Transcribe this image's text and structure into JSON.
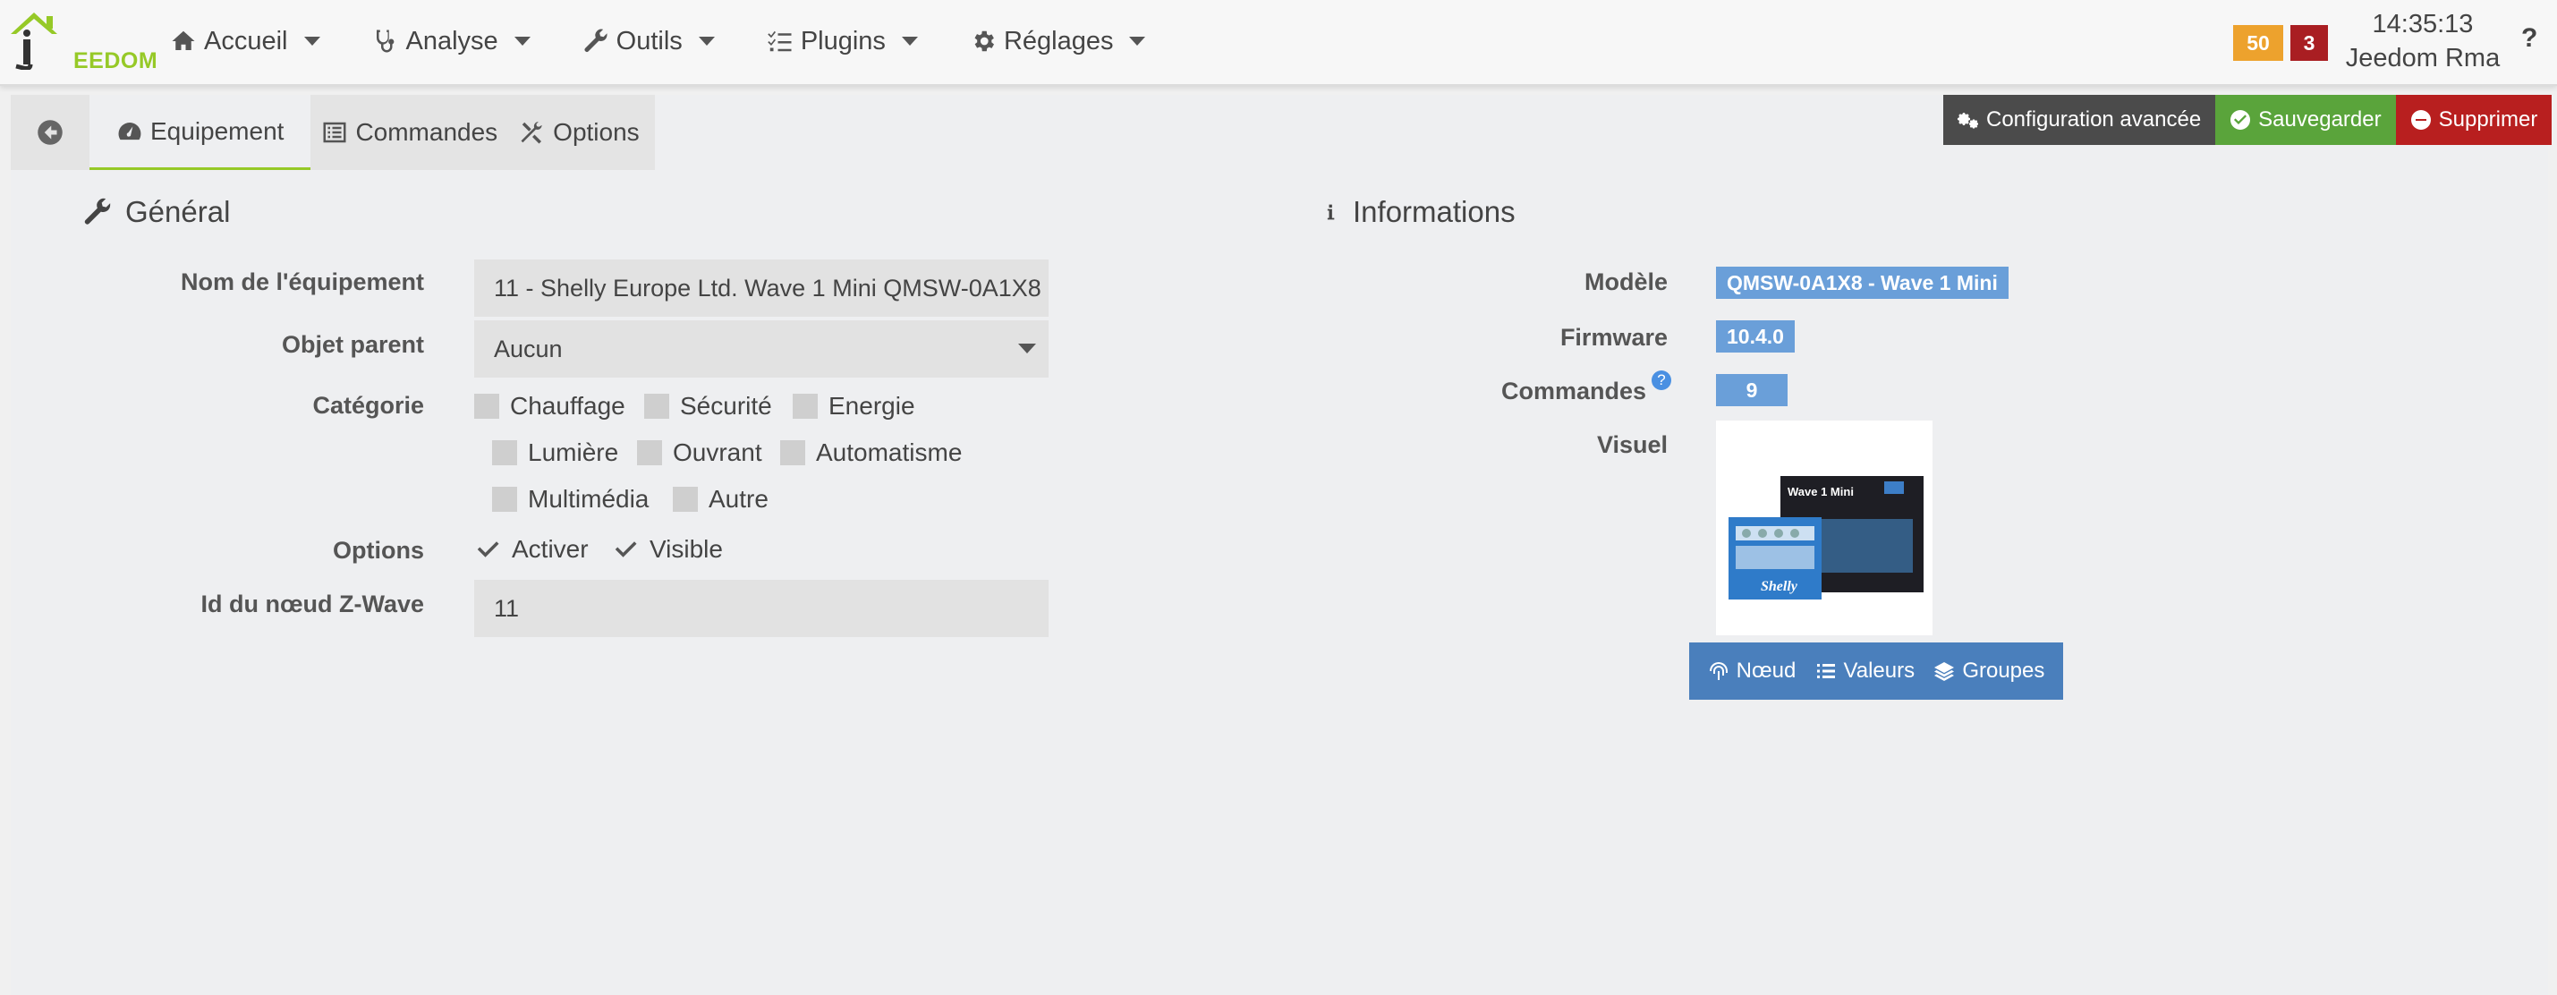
{
  "navbar": {
    "logo_text": "EEDOM",
    "menu": [
      {
        "label": "Accueil",
        "icon": "home-icon"
      },
      {
        "label": "Analyse",
        "icon": "stethoscope-icon"
      },
      {
        "label": "Outils",
        "icon": "wrench-icon"
      },
      {
        "label": "Plugins",
        "icon": "tasks-icon"
      },
      {
        "label": "Réglages",
        "icon": "cog-icon"
      }
    ],
    "badge_orange": "50",
    "badge_red": "3",
    "time": "14:35:13",
    "user": "Jeedom Rma",
    "help": "?"
  },
  "tabs": {
    "equipement": "Equipement",
    "commandes": "Commandes",
    "options": "Options"
  },
  "actions": {
    "config": "Configuration avancée",
    "save": "Sauvegarder",
    "delete": "Supprimer"
  },
  "general": {
    "title": "Général",
    "name_label": "Nom de l'équipement",
    "name_value": "11 - Shelly Europe Ltd. Wave 1 Mini QMSW-0A1X8",
    "parent_label": "Objet parent",
    "parent_value": "Aucun",
    "category_label": "Catégorie",
    "categories": [
      "Chauffage",
      "Sécurité",
      "Energie",
      "Lumière",
      "Ouvrant",
      "Automatisme",
      "Multimédia",
      "Autre"
    ],
    "options_label": "Options",
    "opt_activer": "Activer",
    "opt_visible": "Visible",
    "node_label": "Id du nœud Z-Wave",
    "node_value": "11"
  },
  "info": {
    "title": "Informations",
    "model_label": "Modèle",
    "model_value": "QMSW-0A1X8 - Wave 1 Mini",
    "firmware_label": "Firmware",
    "firmware_value": "10.4.0",
    "commands_label": "Commandes",
    "commands_value": "9",
    "visual_label": "Visuel",
    "product_name": "Wave 1 Mini",
    "product_brand": "Shelly",
    "btn_noeud": "Nœud",
    "btn_valeurs": "Valeurs",
    "btn_groupes": "Groupes"
  },
  "colors": {
    "accent_green": "#96c927",
    "tag_blue": "#6a9fd9",
    "btn_blue": "#4a7fbc",
    "save_green": "#5aa43b",
    "delete_red": "#b81f1f",
    "badge_orange": "#eda22d",
    "badge_red": "#a91e22"
  }
}
